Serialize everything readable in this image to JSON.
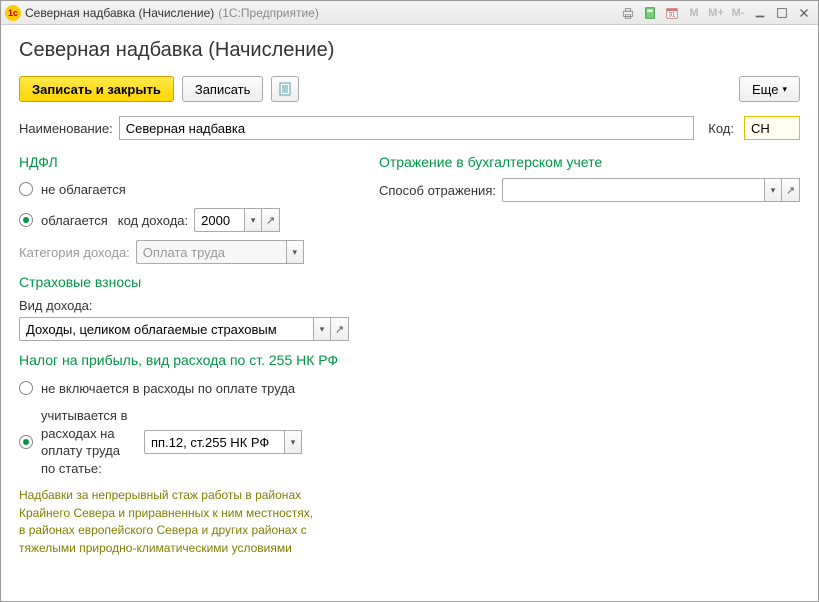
{
  "titlebar": {
    "app_icon": "1c",
    "title": "Северная надбавка (Начисление)",
    "subtitle": "(1С:Предприятие)",
    "m1": "M",
    "m2": "M+",
    "m3": "M-"
  },
  "header": {
    "title": "Северная надбавка (Начисление)"
  },
  "toolbar": {
    "save_close": "Записать и закрыть",
    "save": "Записать",
    "more": "Еще"
  },
  "fields": {
    "name_label": "Наименование:",
    "name_value": "Северная надбавка",
    "code_label": "Код:",
    "code_value": "СН"
  },
  "ndfl": {
    "title": "НДФЛ",
    "opt_not_taxed": "не облагается",
    "opt_taxed": "облагается",
    "income_code_label": "код дохода:",
    "income_code": "2000",
    "category_label": "Категория дохода:",
    "category_value": "Оплата труда"
  },
  "insurance": {
    "title": "Страховые взносы",
    "kind_label": "Вид дохода:",
    "kind_value": "Доходы, целиком облагаемые страховым"
  },
  "profit_tax": {
    "title": "Налог на прибыль, вид расхода по ст. 255 НК РФ",
    "opt_excluded": "не включается в расходы по оплате труда",
    "opt_included": "учитывается в расходах на оплату труда по статье:",
    "article_value": "пп.12, ст.255 НК РФ"
  },
  "description": "Надбавки за непрерывный стаж работы в районах Крайнего Севера и приравненных к ним местностях, в районах европейского Севера и других районах с тяжелыми природно-климатическими условиями",
  "accounting": {
    "title": "Отражение в бухгалтерском учете",
    "method_label": "Способ отражения:",
    "method_value": ""
  }
}
